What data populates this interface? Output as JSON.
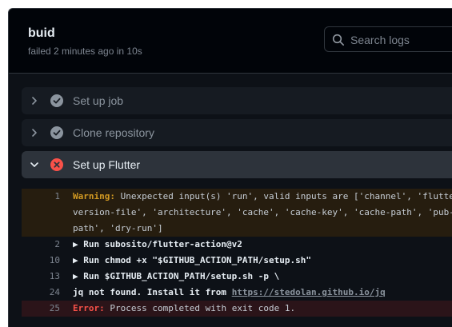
{
  "job": {
    "title": "buid",
    "status_text": "failed 2 minutes ago in 10s"
  },
  "search": {
    "placeholder": "Search logs"
  },
  "steps": [
    {
      "label": "Set up job",
      "status": "success",
      "expanded": false
    },
    {
      "label": "Clone repository",
      "status": "success",
      "expanded": false
    },
    {
      "label": "Set up Flutter",
      "status": "failure",
      "expanded": true
    }
  ],
  "log": {
    "lines": [
      {
        "number": "1",
        "prefix": "Warning:",
        "text": " Unexpected input(s) 'run', valid inputs are ['channel', 'flutte"
      },
      {
        "number": "",
        "text": "version-file', 'architecture', 'cache', 'cache-key', 'cache-path', 'pub-"
      },
      {
        "number": "",
        "text": "path', 'dry-run']"
      },
      {
        "number": "2",
        "marker": "▶",
        "text": " Run subosito/flutter-action@v2"
      },
      {
        "number": "10",
        "marker": "▶",
        "text": " Run chmod +x \"$GITHUB_ACTION_PATH/setup.sh\""
      },
      {
        "number": "13",
        "marker": "▶",
        "text": " Run $GITHUB_ACTION_PATH/setup.sh -p \\"
      },
      {
        "number": "24",
        "text": "jq not found. Install it from ",
        "link": "https://stedolan.github.io/jq"
      },
      {
        "number": "25",
        "prefix": "Error:",
        "text": " Process completed with exit code 1."
      }
    ]
  },
  "colors": {
    "background": "#0d1117",
    "header_bg": "#010409",
    "success_icon": "#8b949e",
    "failure_icon": "#f85149",
    "warning": "#d29922",
    "error": "#f85149"
  },
  "icons": {
    "search": "search-icon",
    "success": "check-circle-icon",
    "failure": "x-circle-icon",
    "collapsed": "chevron-right-icon",
    "expanded": "chevron-down-icon"
  }
}
